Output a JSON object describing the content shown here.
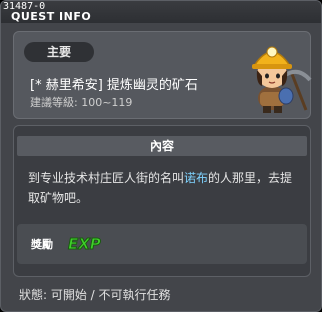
{
  "window": {
    "quest_id": "31487-0",
    "title": "QUEST INFO"
  },
  "info": {
    "badge": "主要",
    "quest_name": "[* 赫里希安] 提炼幽灵的矿石",
    "level": "建議等級: 100~119"
  },
  "content": {
    "header": "內容",
    "desc_before": "到专业技术村庄匠人街的名叫",
    "desc_npc": "诺布",
    "desc_after": "的人那里，去提取矿物吧。"
  },
  "reward": {
    "label": "獎勵",
    "exp": "EXP"
  },
  "status": {
    "text": "狀態:  可開始 / 不可執行任務"
  },
  "colors": {
    "npc_name": "#7fd3ff",
    "exp_green": "#3fd12a"
  }
}
